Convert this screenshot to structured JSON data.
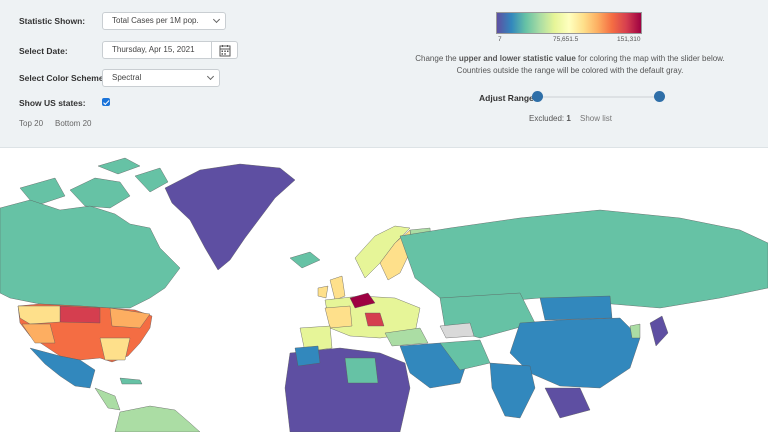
{
  "controls": {
    "statistic": {
      "label": "Statistic Shown:",
      "value": "Total Cases per 1M pop."
    },
    "date": {
      "label": "Select Date:",
      "value": "Thursday, Apr 15, 2021"
    },
    "scheme": {
      "label": "Select Color Scheme:",
      "value": "Spectral"
    },
    "us_states": {
      "label": "Show US states:",
      "checked": true
    },
    "top_link": "Top 20",
    "bottom_link": "Bottom 20"
  },
  "legend": {
    "min": "7",
    "mid": "75,651.5",
    "max": "151,310",
    "colors": [
      "#5e4fa2",
      "#3288bd",
      "#66c2a5",
      "#abdda4",
      "#e6f598",
      "#ffffbf",
      "#fee08b",
      "#fdae61",
      "#f46d43",
      "#d53e4f",
      "#9e0142"
    ]
  },
  "info": {
    "pre": "Change the ",
    "bold": "upper and lower statistic value",
    "post": " for coloring the map with the slider below.",
    "line2": "Countries outside the range will be colored with the default gray."
  },
  "range": {
    "label": "Adjust Range:",
    "low_fraction": 0.0,
    "high_fraction": 1.0
  },
  "excluded": {
    "label": "Excluded:",
    "count": "1",
    "show_list": "Show list"
  },
  "map_colors": {
    "greenland": "#5e4fa2",
    "canada": "#66c2a5",
    "usa_high": "#f46d43",
    "russia": "#66c2a5",
    "china": "#3288bd",
    "europe": "#e6f598",
    "czechia": "#9e0142",
    "africa": "#5e4fa2",
    "excluded_gray": "#d9d9d9"
  }
}
